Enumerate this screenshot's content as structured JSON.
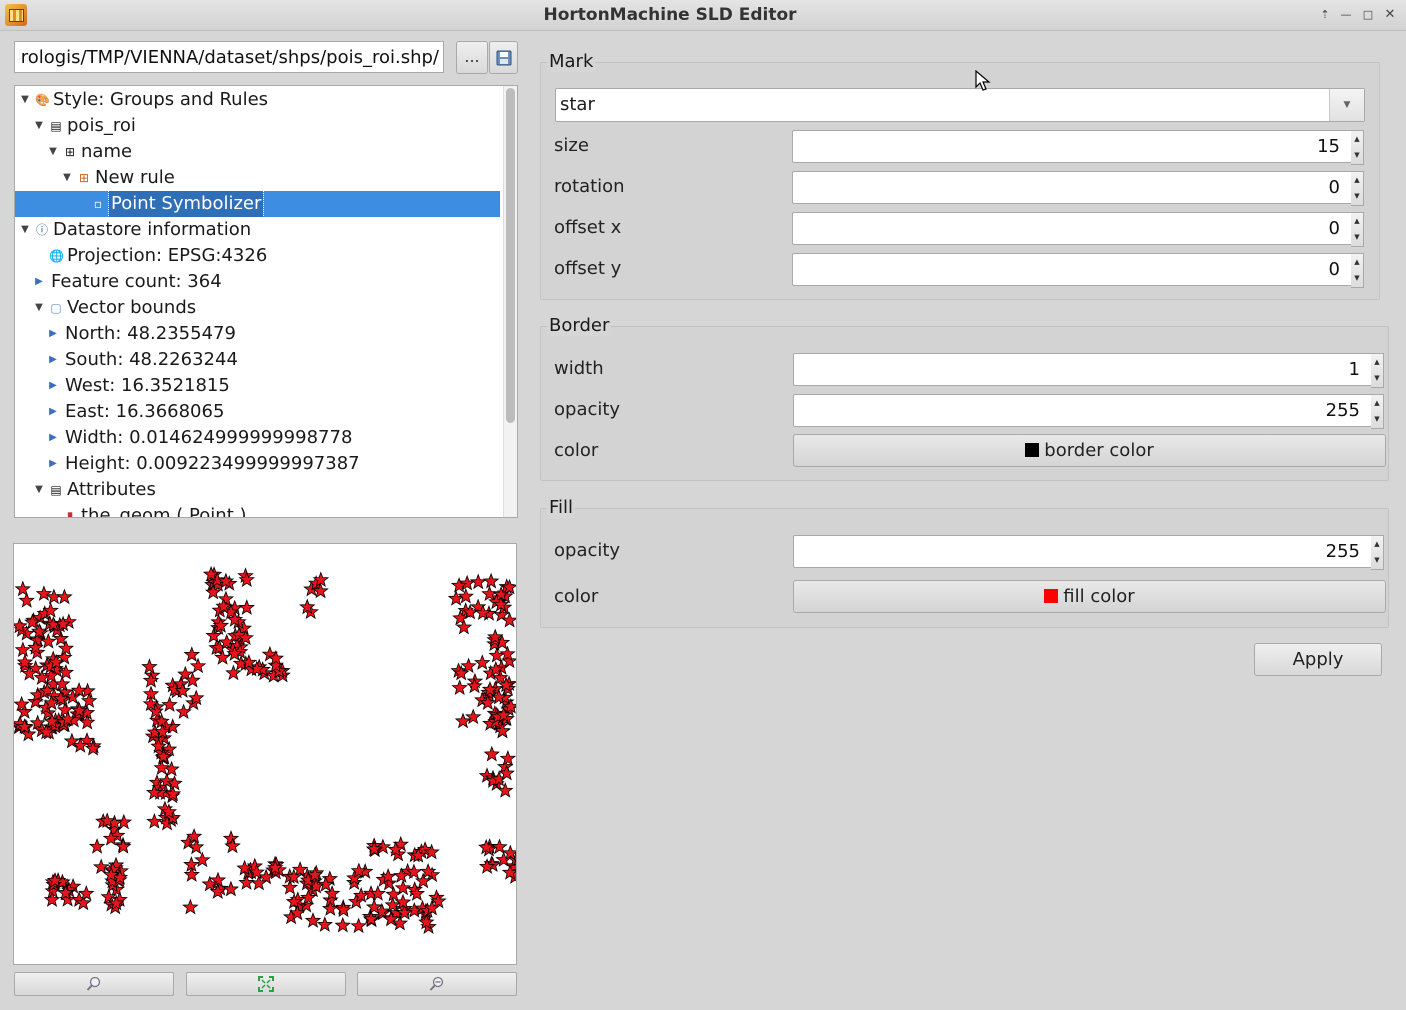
{
  "window": {
    "title": "HortonMachine SLD Editor",
    "controls": [
      "⇡",
      "—",
      "□",
      "✕"
    ]
  },
  "file": {
    "path": "/drologis/TMP/VIENNA/dataset/shps/pois_roi.shp",
    "browse_label": "...",
    "save_icon": "floppy-disk-icon"
  },
  "tree": {
    "rows": [
      {
        "label": "Style: Groups and Rules",
        "icon": "style-palette-icon",
        "expanded": true
      },
      {
        "label": "pois_roi",
        "icon": "feature-type-icon",
        "expanded": true
      },
      {
        "label": "name",
        "icon": "grid-icon",
        "expanded": true
      },
      {
        "label": "New rule",
        "icon": "rule-icon",
        "expanded": true
      },
      {
        "label": "Point Symbolizer",
        "icon": "point-icon",
        "selected": true
      },
      {
        "label": "Datastore information",
        "icon": "info-icon",
        "expanded": true
      },
      {
        "label": "Projection: EPSG:4326",
        "icon": "globe-icon"
      },
      {
        "label": "Feature count: 364",
        "collapsed": true
      },
      {
        "label": "Vector bounds",
        "icon": "bounds-icon",
        "expanded": true
      },
      {
        "label": "North: 48.2355479",
        "collapsed": true
      },
      {
        "label": "South: 48.2263244",
        "collapsed": true
      },
      {
        "label": "West: 16.3521815",
        "collapsed": true
      },
      {
        "label": "East: 16.3668065",
        "collapsed": true
      },
      {
        "label": "Width: 0.014624999999998778",
        "collapsed": true
      },
      {
        "label": "Height: 0.009223499999997387",
        "collapsed": true
      },
      {
        "label": "Attributes",
        "icon": "table-icon",
        "expanded": true
      },
      {
        "label": "the_geom ( Point )",
        "icon": "geom-icon"
      }
    ]
  },
  "map": {
    "symbol_fill": "#e8141c",
    "symbol_stroke": "#000000",
    "buttons": [
      "zoom-in-icon",
      "zoom-to-extent-icon",
      "zoom-out-icon"
    ]
  },
  "mark": {
    "label": "Mark",
    "shape_value": "star",
    "fields": [
      {
        "label": "size",
        "value": "15"
      },
      {
        "label": "rotation",
        "value": "0"
      },
      {
        "label": "offset x",
        "value": "0"
      },
      {
        "label": "offset y",
        "value": "0"
      }
    ]
  },
  "border": {
    "label": "Border",
    "width_label": "width",
    "width_value": "1",
    "opacity_label": "opacity",
    "opacity_value": "255",
    "color_label": "color",
    "color_button": "border color",
    "color": "#000000"
  },
  "fill": {
    "label": "Fill",
    "opacity_label": "opacity",
    "opacity_value": "255",
    "color_label": "color",
    "color_button": "fill color",
    "color": "#ff0000"
  },
  "apply_label": "Apply"
}
